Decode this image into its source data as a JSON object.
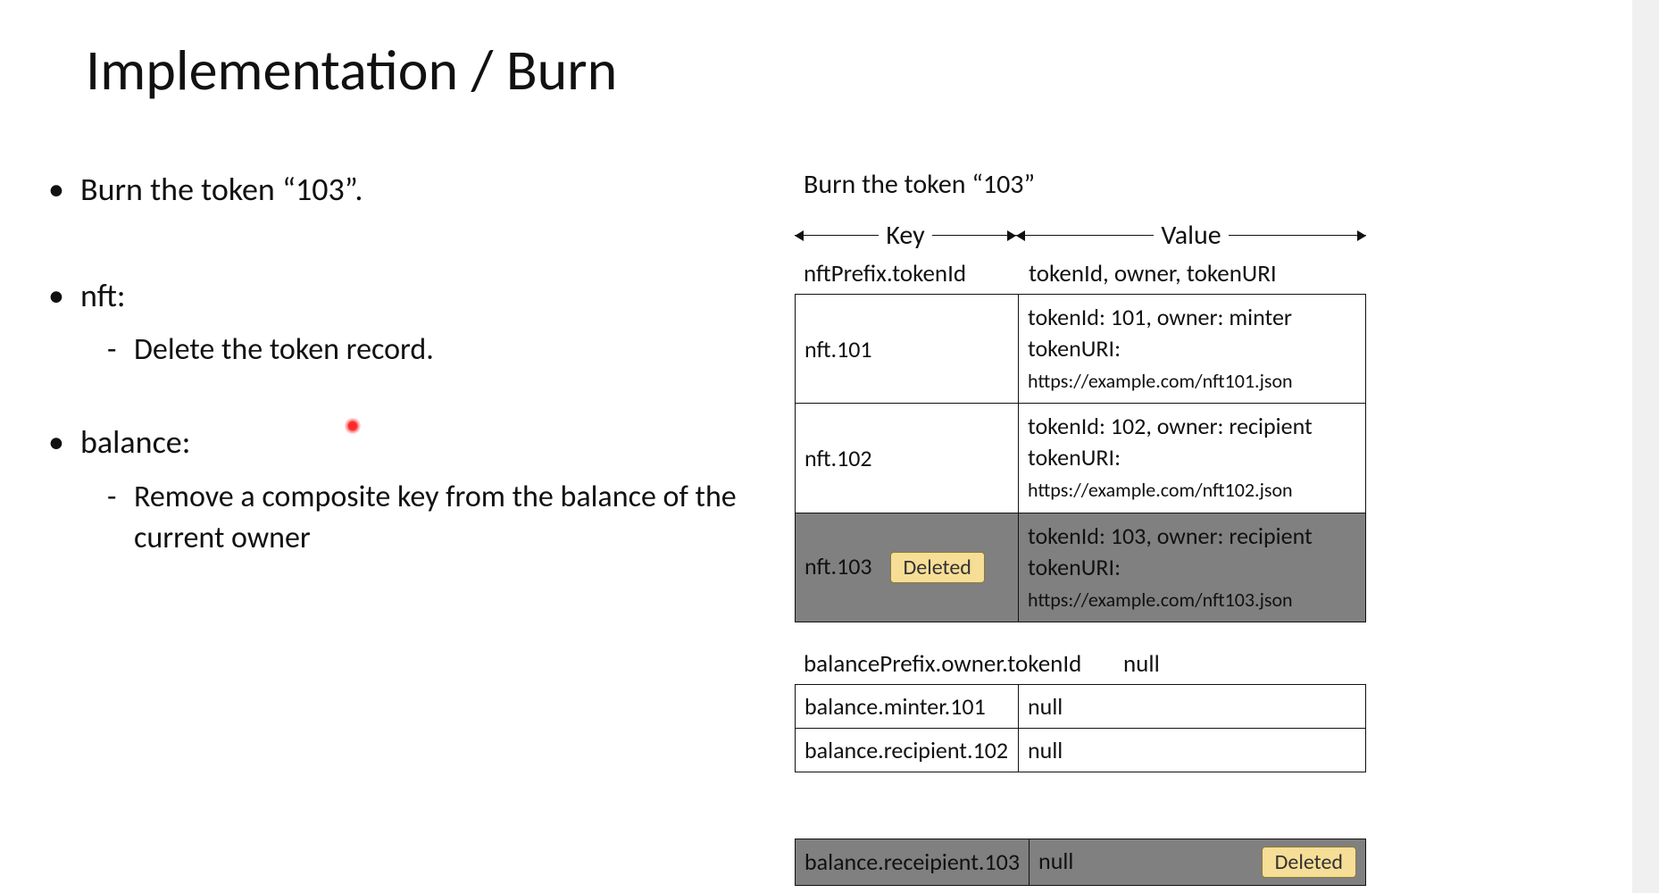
{
  "title": "Implementation / Burn",
  "bullets": {
    "b1": "Burn the token “103”.",
    "b2": "nft:",
    "b2s1": "Delete the token record.",
    "b3": "balance:",
    "b3s1": "Remove a composite key from the balance of the current owner"
  },
  "diagram": {
    "title": "Burn the token “103”",
    "keyLabel": "Key",
    "valueLabel": "Value",
    "nftSchema": {
      "k": "nftPrefix.tokenId",
      "v": "tokenId, owner, tokenURI"
    },
    "nftRows": [
      {
        "k": "nft.101",
        "v1": "tokenId: 101, owner: minter",
        "v2a": "tokenURI: ",
        "v2b": "https://example.com/nft101.json",
        "deleted": false
      },
      {
        "k": "nft.102",
        "v1": "tokenId: 102, owner: recipient",
        "v2a": "tokenURI: ",
        "v2b": "https://example.com/nft102.json",
        "deleted": false
      },
      {
        "k": "nft.103",
        "v1": "tokenId: 103, owner: recipient",
        "v2a": "tokenURI: ",
        "v2b": "https://example.com/nft103.json",
        "deleted": true,
        "badge": "Deleted"
      }
    ],
    "balanceSchema": {
      "k": "balancePrefix.owner.tokenId",
      "v": "null"
    },
    "balanceRows": [
      {
        "k": "balance.minter.101",
        "v": "null",
        "deleted": false
      },
      {
        "k": "balance.recipient.102",
        "v": "null",
        "deleted": false
      }
    ],
    "balanceDeletedRow": {
      "k": "balance.receipient.103",
      "v": "null",
      "badge": "Deleted"
    }
  }
}
